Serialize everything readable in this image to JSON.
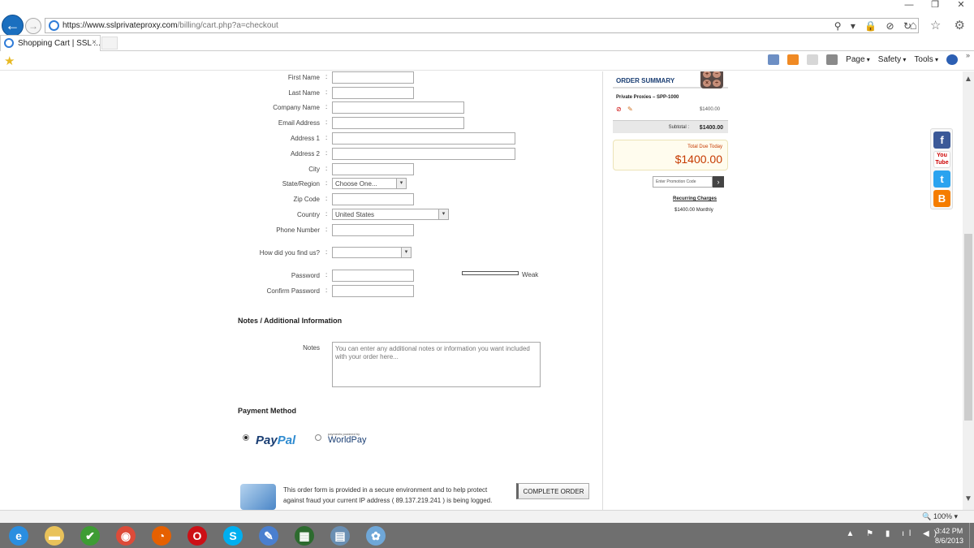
{
  "browser": {
    "url_host": "https://www.sslprivateproxy.com",
    "url_path": "/billing/cart.php?a=checkout",
    "tab_label": "Shopping Cart | SSL ...",
    "tab_close": "×",
    "back_glyph": "←",
    "forward_glyph": "→",
    "address_icons": "⚲ ▾ 🔒 ⊘ ↻",
    "right_icons": "⌂ ☆ ⚙",
    "window_controls": {
      "min": "—",
      "max": "❐",
      "close": "✕"
    },
    "commands": [
      "Page",
      "Safety",
      "Tools"
    ],
    "more": "»",
    "zoom": "🔍 100% ▾"
  },
  "form": {
    "fields": [
      {
        "label": "First Name",
        "type": "input",
        "width": "short"
      },
      {
        "label": "Last Name",
        "type": "input",
        "width": "short"
      },
      {
        "label": "Company Name",
        "type": "input",
        "width": "medium"
      },
      {
        "label": "Email Address",
        "type": "input",
        "width": "medium"
      },
      {
        "label": "Address 1",
        "type": "input",
        "width": "long"
      },
      {
        "label": "Address 2",
        "type": "input",
        "width": "long"
      },
      {
        "label": "City",
        "type": "input",
        "width": "short"
      },
      {
        "label": "State/Region",
        "type": "select",
        "value": "Choose One..."
      },
      {
        "label": "Zip Code",
        "type": "input",
        "width": "short"
      },
      {
        "label": "Country",
        "type": "select",
        "value": "United States"
      },
      {
        "label": "Phone Number",
        "type": "input",
        "width": "short"
      },
      {
        "label": "How did you find us?",
        "type": "select",
        "value": ""
      },
      {
        "label": "Password",
        "type": "input",
        "width": "short"
      },
      {
        "label": "Confirm Password",
        "type": "input",
        "width": "short"
      }
    ],
    "password_strength": "Weak",
    "colon": ":",
    "notes_section_title": "Notes / Additional Information",
    "notes_label": "Notes",
    "notes_placeholder": "You can enter any additional notes or information you want included with your order here...",
    "payment_title": "Payment Method",
    "payment_options": {
      "paypal": {
        "pay": "Pay",
        "pal": "Pal",
        "selected": true
      },
      "worldpay": {
        "small": "payments powered by",
        "name": "WorldPay",
        "selected": false
      }
    },
    "secure_text": "This order form is provided in a secure environment and to help protect against fraud your current IP address ( 89.137.219.241 ) is being logged.",
    "complete_button": "COMPLETE ORDER"
  },
  "summary": {
    "title": "ORDER SUMMARY",
    "item_name": "Private Proxies – SPP-1000",
    "item_price": "$1400.00",
    "remove_glyph": "⊘",
    "edit_glyph": "✎",
    "subtotal_label": "Subtotal :",
    "subtotal_value": "$1400.00",
    "total_label": "Total Due Today",
    "total_value": "$1400.00",
    "promo_placeholder": "Enter Promotion Code",
    "promo_glyph": "›",
    "recurring_title": "Recurring Charges",
    "recurring_value": "$1400.00 Monthly",
    "calc_keys": [
      "+",
      "−",
      "×",
      "÷"
    ]
  },
  "social": {
    "facebook": "f",
    "youtube": "You Tube",
    "twitter": "t",
    "blogger": "B"
  },
  "taskbar": {
    "apps": [
      {
        "name": "ie",
        "glyph": "e",
        "color": "#2a8ee0"
      },
      {
        "name": "explorer",
        "glyph": "▬",
        "color": "#e9c25a"
      },
      {
        "name": "check",
        "glyph": "✔",
        "color": "#3e9c34"
      },
      {
        "name": "chrome",
        "glyph": "◉",
        "color": "#dd4b39"
      },
      {
        "name": "firefox",
        "glyph": "◔",
        "color": "#e66000"
      },
      {
        "name": "opera",
        "glyph": "O",
        "color": "#cc0f16"
      },
      {
        "name": "skype",
        "glyph": "S",
        "color": "#00aff0"
      },
      {
        "name": "notes",
        "glyph": "✎",
        "color": "#4a7fcf"
      },
      {
        "name": "flag",
        "glyph": "▦",
        "color": "#2d6b2f"
      },
      {
        "name": "calculator",
        "glyph": "▤",
        "color": "#6a8fb3"
      },
      {
        "name": "paint",
        "glyph": "✿",
        "color": "#6fa7d8"
      }
    ],
    "tray": "▲ ⚑ ▮ ıl ◀)",
    "time": "3:42 PM",
    "date": "8/6/2013"
  },
  "scroll": {
    "up": "▲",
    "down": "▼"
  },
  "fav_star": "★"
}
